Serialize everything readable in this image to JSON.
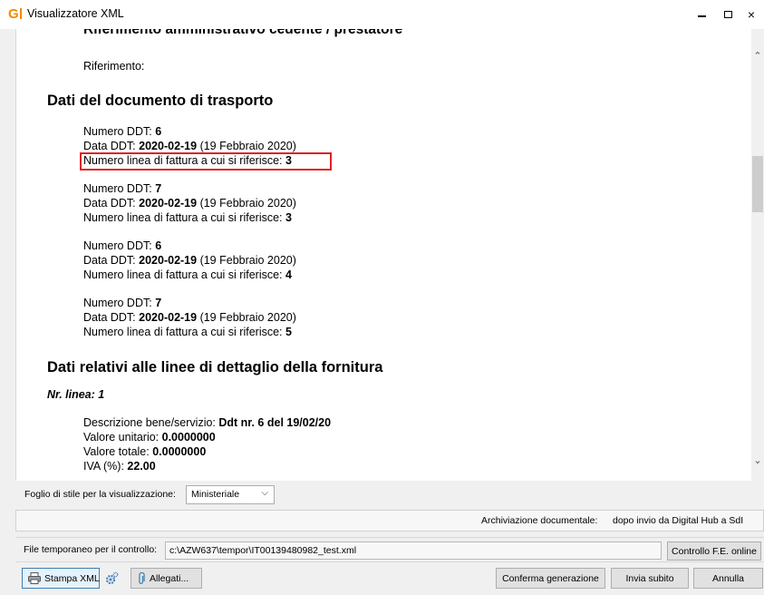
{
  "window": {
    "title": "Visualizzatore XML",
    "logo_letter": "G",
    "controls": {
      "minimize": "minimize",
      "maximize": "maximize",
      "close": "×"
    }
  },
  "document": {
    "cut_heading": "Riferimento amministrativo cedente / prestatore",
    "reference_label": "Riferimento:",
    "transport_section_title": "Dati del documento di trasporto",
    "ddt_entries": [
      {
        "numero_label": "Numero DDT: ",
        "numero": "6",
        "data_label": "Data DDT: ",
        "data": "2020-02-19",
        "data_text": " (19 Febbraio 2020)",
        "linea_label": "Numero linea di fattura a cui si riferisce: ",
        "linea": "3"
      },
      {
        "numero_label": "Numero DDT: ",
        "numero": "7",
        "data_label": "Data DDT: ",
        "data": "2020-02-19",
        "data_text": " (19 Febbraio 2020)",
        "linea_label": "Numero linea di fattura a cui si riferisce: ",
        "linea": "3"
      },
      {
        "numero_label": "Numero DDT: ",
        "numero": "6",
        "data_label": "Data DDT: ",
        "data": "2020-02-19",
        "data_text": " (19 Febbraio 2020)",
        "linea_label": "Numero linea di fattura a cui si riferisce: ",
        "linea": "4"
      },
      {
        "numero_label": "Numero DDT: ",
        "numero": "7",
        "data_label": "Data DDT: ",
        "data": "2020-02-19",
        "data_text": " (19 Febbraio 2020)",
        "linea_label": "Numero linea di fattura a cui si riferisce: ",
        "linea": "5"
      }
    ],
    "detail_section_title": "Dati relativi alle linee di dettaglio della fornitura",
    "line_label": "Nr. linea: 1",
    "detail": {
      "descrizione_label": "Descrizione bene/servizio: ",
      "descrizione": "Ddt nr. 6 del 19/02/20",
      "unitario_label": "Valore unitario: ",
      "unitario": "0.0000000",
      "totale_label": "Valore totale: ",
      "totale": "0.0000000",
      "iva_label": "IVA (%): ",
      "iva": "22.00"
    },
    "highlight_color": "#e02020"
  },
  "stylesheet": {
    "label": "Foglio di stile per la visualizzazione:",
    "selected": "Ministeriale"
  },
  "archive": {
    "label": "Archiviazione documentale:",
    "value": "dopo invio da Digital Hub a SdI"
  },
  "temp_file": {
    "label": "File temporaneo per il controllo:",
    "value": "c:\\AZW637\\tempor\\IT00139480982_test.xml",
    "check_button": "Controllo F.E. online"
  },
  "actions": {
    "print_xml": "Stampa XML",
    "attachments": "Allegati...",
    "confirm": "Conferma generazione",
    "send_now": "Invia subito",
    "cancel": "Annulla"
  },
  "colors": {
    "logo": "#f28a00",
    "primary_button_border": "#3c7fb1"
  }
}
